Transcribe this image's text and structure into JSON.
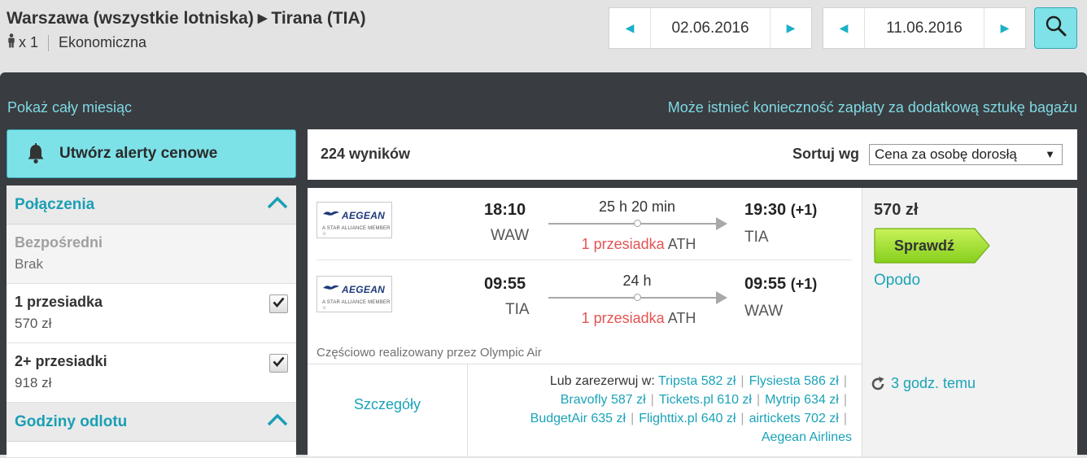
{
  "search": {
    "origin": "Warszawa (wszystkie lotniska)",
    "destination": "Tirana (TIA)",
    "passengers": "x 1",
    "cabin": "Ekonomiczna",
    "depart_date": "02.06.2016",
    "return_date": "11.06.2016"
  },
  "icons": {
    "arrow": "▶",
    "prev": "◀",
    "next": "▶",
    "search": "magnifier-icon",
    "person": "person-icon",
    "bell": "bell-icon",
    "chevron": "chevron-up-icon",
    "check": "checkmark-icon",
    "refresh": "refresh-icon"
  },
  "links": {
    "show_month": "Pokaż cały miesiąc",
    "baggage_note": "Może istnieć konieczność zapłaty za dodatkową sztukę bagażu"
  },
  "alert_button": "Utwórz alerty cenowe",
  "filters": {
    "connections": {
      "title": "Połączenia",
      "options": [
        {
          "name": "Bezpośredni",
          "value": "Brak",
          "enabled": false,
          "checked": false
        },
        {
          "name": "1 przesiadka",
          "value": "570 zł",
          "enabled": true,
          "checked": true
        },
        {
          "name": "2+ przesiadki",
          "value": "918 zł",
          "enabled": true,
          "checked": true
        }
      ]
    },
    "departure_times": {
      "title": "Godziny odlotu"
    }
  },
  "results": {
    "count": "224 wyników",
    "sort_label": "Sortuj wg",
    "sort_value": "Cena za osobę dorosłą"
  },
  "result": {
    "airline": "AEGEAN",
    "airline_tagline": "A STAR ALLIANCE MEMBER ☆",
    "legs": [
      {
        "dep_time": "18:10",
        "dep_code": "WAW",
        "duration": "25 h 20 min",
        "stops": "1 przesiadka",
        "via": "ATH",
        "arr_time": "19:30",
        "arr_plus": "(+1)",
        "arr_code": "TIA"
      },
      {
        "dep_time": "09:55",
        "dep_code": "TIA",
        "duration": "24 h",
        "stops": "1 przesiadka",
        "via": "ATH",
        "arr_time": "09:55",
        "arr_plus": "(+1)",
        "arr_code": "WAW"
      }
    ],
    "operated_by": "Częściowo realizowany przez Olympic Air",
    "details": "Szczegóły",
    "price": "570 zł",
    "check_button": "Sprawdź",
    "provider": "Opodo",
    "updated": "3 godz. temu",
    "other_label": "Lub zarezerwuj w:",
    "other_providers": [
      {
        "name": "Tripsta",
        "price": "582 zł"
      },
      {
        "name": "Flysiesta",
        "price": "586 zł"
      },
      {
        "name": "Bravofly",
        "price": "587 zł"
      },
      {
        "name": "Tickets.pl",
        "price": "610 zł"
      },
      {
        "name": "Mytrip",
        "price": "634 zł"
      },
      {
        "name": "BudgetAir",
        "price": "635 zł"
      },
      {
        "name": "Flighttix.pl",
        "price": "640 zł"
      },
      {
        "name": "airtickets",
        "price": "702 zł"
      },
      {
        "name": "Aegean Airlines",
        "price": ""
      }
    ]
  },
  "colors": {
    "accent": "#1aa3b8",
    "button_cyan": "#7de2e8",
    "panel": "#393c40",
    "green_button": "#9bde2c",
    "stops_red": "#e35454"
  }
}
